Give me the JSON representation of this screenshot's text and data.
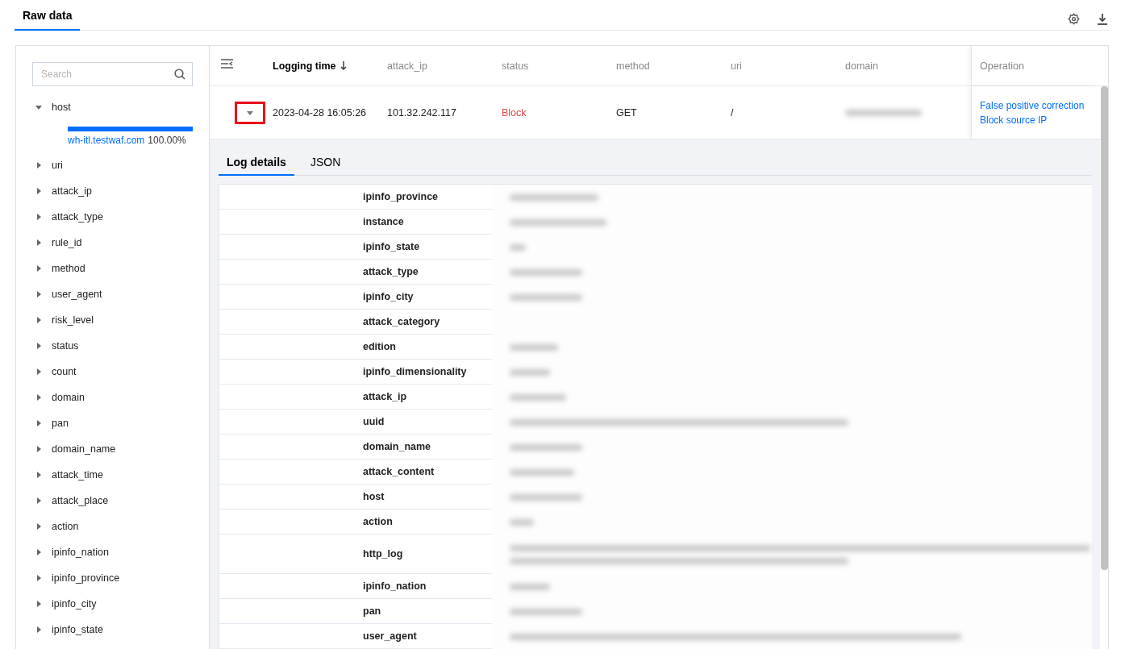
{
  "tabs": [
    {
      "label": "Raw data",
      "selected": true
    }
  ],
  "sidebar": {
    "search": {
      "placeholder": "Search"
    },
    "fields": [
      {
        "label": "host",
        "expanded": true,
        "children": [
          {
            "value": "wh-itl.testwaf.com",
            "percent": "100.00%",
            "level": 1
          }
        ]
      },
      {
        "label": "uri",
        "expanded": false
      },
      {
        "label": "attack_ip",
        "expanded": false
      },
      {
        "label": "attack_type",
        "expanded": false
      },
      {
        "label": "rule_id",
        "expanded": false
      },
      {
        "label": "method",
        "expanded": false
      },
      {
        "label": "user_agent",
        "expanded": false
      },
      {
        "label": "risk_level",
        "expanded": false
      },
      {
        "label": "status",
        "expanded": false
      },
      {
        "label": "count",
        "expanded": false
      },
      {
        "label": "domain",
        "expanded": false
      },
      {
        "label": "pan",
        "expanded": false
      },
      {
        "label": "domain_name",
        "expanded": false
      },
      {
        "label": "attack_time",
        "expanded": false
      },
      {
        "label": "attack_place",
        "expanded": false
      },
      {
        "label": "action",
        "expanded": false
      },
      {
        "label": "ipinfo_nation",
        "expanded": false
      },
      {
        "label": "ipinfo_province",
        "expanded": false
      },
      {
        "label": "ipinfo_city",
        "expanded": false
      },
      {
        "label": "ipinfo_state",
        "expanded": false
      }
    ]
  },
  "table": {
    "columns": [
      {
        "label": "Logging time",
        "sorted": true
      },
      {
        "label": "attack_ip",
        "sorted": false
      },
      {
        "label": "status",
        "sorted": false
      },
      {
        "label": "method",
        "sorted": false
      },
      {
        "label": "uri",
        "sorted": false
      },
      {
        "label": "domain",
        "sorted": false
      }
    ],
    "operation_header": "Operation",
    "rows": [
      {
        "expanded": true,
        "cells": [
          {
            "kind": "text",
            "text": "2023-04-28 16:05:26"
          },
          {
            "kind": "text",
            "text": "101.32.242.117"
          },
          {
            "kind": "status",
            "text": "Block",
            "color": "#e54545"
          },
          {
            "kind": "text",
            "text": "GET"
          },
          {
            "kind": "text",
            "text": "/"
          },
          {
            "kind": "blurred"
          }
        ],
        "operations": [
          "False positive correction",
          "Block source IP"
        ]
      }
    ]
  },
  "details": {
    "tabs": [
      {
        "label": "Log details",
        "selected": true
      },
      {
        "label": "JSON",
        "selected": false
      }
    ],
    "rows": [
      {
        "key": "ipinfo_province",
        "kind": "value"
      },
      {
        "key": "instance",
        "kind": "value"
      },
      {
        "key": "ipinfo_state",
        "kind": "value"
      },
      {
        "key": "attack_type",
        "kind": "value"
      },
      {
        "key": "ipinfo_city",
        "kind": "value"
      },
      {
        "key": "attack_category",
        "kind": "empty"
      },
      {
        "key": "edition",
        "kind": "value"
      },
      {
        "key": "ipinfo_dimensionality",
        "kind": "value"
      },
      {
        "key": "attack_ip",
        "kind": "value"
      },
      {
        "key": "uuid",
        "kind": "value"
      },
      {
        "key": "domain_name",
        "kind": "value"
      },
      {
        "key": "attack_content",
        "kind": "value"
      },
      {
        "key": "host",
        "kind": "value"
      },
      {
        "key": "action",
        "kind": "value"
      },
      {
        "key": "http_log",
        "kind": "long"
      },
      {
        "key": "ipinfo_nation",
        "kind": "value"
      },
      {
        "key": "pan",
        "kind": "value"
      },
      {
        "key": "user_agent",
        "kind": "value"
      }
    ]
  }
}
